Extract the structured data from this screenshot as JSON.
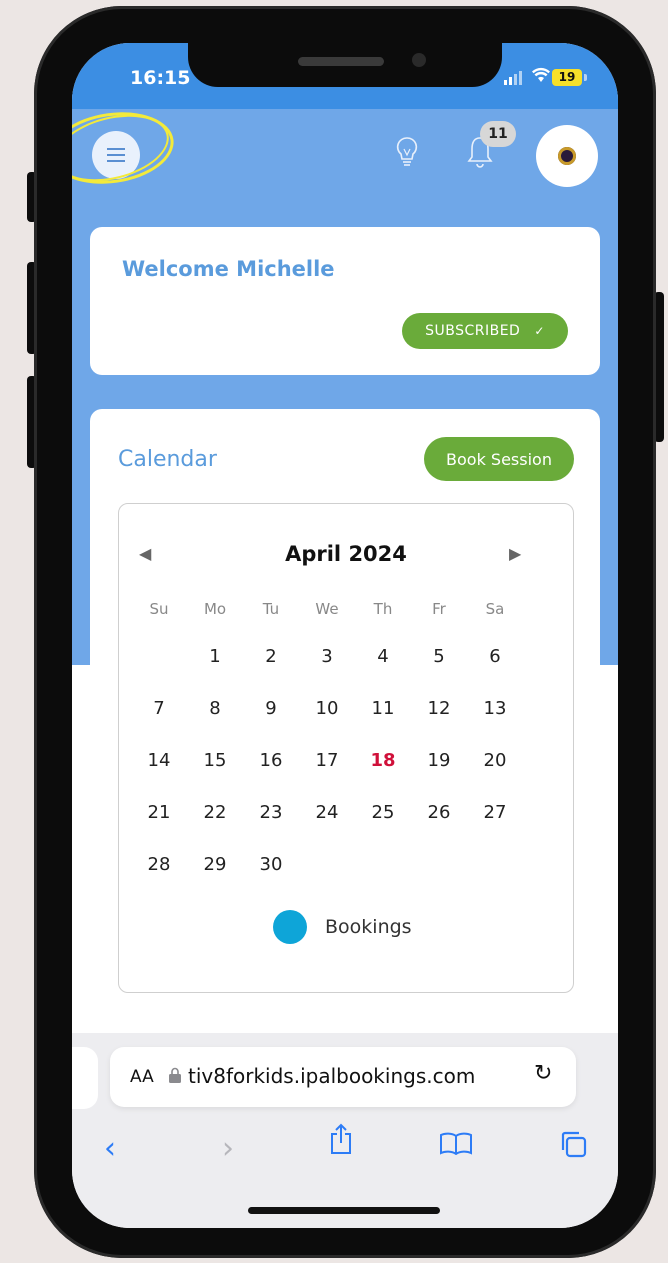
{
  "status_bar": {
    "time": "16:15",
    "battery": "19"
  },
  "header": {
    "notifications_count": "11"
  },
  "welcome": {
    "title": "Welcome Michelle",
    "badge": "SUBSCRIBED",
    "badge_check": "✓"
  },
  "calendar": {
    "title": "Calendar",
    "book_button": "Book Session",
    "prev": "◀",
    "next": "▶",
    "month": "April 2024",
    "weekdays": [
      "Su",
      "Mo",
      "Tu",
      "We",
      "Th",
      "Fr",
      "Sa"
    ],
    "weeks": [
      [
        "",
        "1",
        "2",
        "3",
        "4",
        "5",
        "6"
      ],
      [
        "7",
        "8",
        "9",
        "10",
        "11",
        "12",
        "13"
      ],
      [
        "14",
        "15",
        "16",
        "17",
        "18",
        "19",
        "20"
      ],
      [
        "21",
        "22",
        "23",
        "24",
        "25",
        "26",
        "27"
      ],
      [
        "28",
        "29",
        "30",
        "",
        "",
        "",
        ""
      ]
    ],
    "today": "18",
    "legend": "Bookings",
    "legend_color": "#0ea5d8"
  },
  "browser": {
    "aa": "AA",
    "url": "tiv8forkids.ipalbookings.com",
    "reload": "↻",
    "toolbar": {
      "back": "‹",
      "forward": "›"
    }
  },
  "colors": {
    "header_blue": "#6fa7e8",
    "status_blue": "#3c8ee3",
    "title_blue": "#5a9bdc",
    "button_green": "#6aab3a",
    "today_red": "#d0103a",
    "highlight_yellow": "#f3ea3a",
    "safari_blue": "#2d7cf6"
  }
}
